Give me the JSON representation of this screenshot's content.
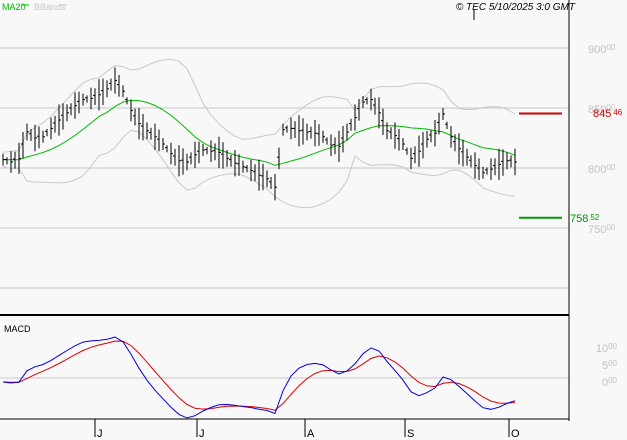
{
  "header": {
    "legend_ma": "MA20",
    "legend_bbands": "BBands",
    "copyright": "© TEC 5/10/2025 3:0 GMT"
  },
  "macd_panel": {
    "label": "MACD"
  },
  "colors": {
    "ma": "#00bb00",
    "bbands": "#c8c8c8",
    "macd": "#0000dd",
    "signal": "#dd0000",
    "high_marker": "#cc0000",
    "low_marker": "#009900",
    "grid": "#c8c8c8",
    "axis_text": "#c0c0c0"
  },
  "chart_data": {
    "type": "bar",
    "title": "",
    "price_axis": {
      "ticks": [
        {
          "value": 900,
          "label": "900.00"
        },
        {
          "value": 850,
          "label": "850.00"
        },
        {
          "value": 800,
          "label": "800.00"
        },
        {
          "value": 750,
          "label": "750.00"
        }
      ],
      "ylim": [
        700,
        940
      ]
    },
    "macd_axis": {
      "ticks": [
        {
          "value": 10,
          "label": "10.00"
        },
        {
          "value": 5,
          "label": "5.00"
        },
        {
          "value": 0,
          "label": "0.00"
        }
      ],
      "ylim": [
        -11,
        19
      ]
    },
    "months": [
      "J",
      "J",
      "A",
      "S",
      "O"
    ],
    "month_index": [
      11.5,
      24.25,
      37.75,
      50.25,
      63.25
    ],
    "closes": [
      807,
      805,
      808,
      830,
      825,
      826,
      833,
      840,
      846,
      852,
      857,
      858,
      861,
      866,
      873,
      864,
      848,
      837,
      831,
      826,
      820,
      812,
      806,
      805,
      811,
      815,
      814,
      813,
      808,
      804,
      801,
      798,
      794,
      791,
      784,
      832,
      833,
      831,
      830,
      829,
      826,
      819,
      818,
      830,
      842,
      855,
      857,
      846,
      831,
      827,
      820,
      808,
      814,
      824,
      829,
      845,
      826,
      816,
      809,
      802,
      796,
      799,
      803,
      806,
      805
    ],
    "indicators": [
      "MA20",
      "BBands",
      "MACD"
    ],
    "high_marker": {
      "value": 845.46,
      "label_int": "845",
      "label_dec": "46"
    },
    "low_marker": {
      "value": 758.52,
      "label_int": "758",
      "label_dec": "52"
    }
  }
}
